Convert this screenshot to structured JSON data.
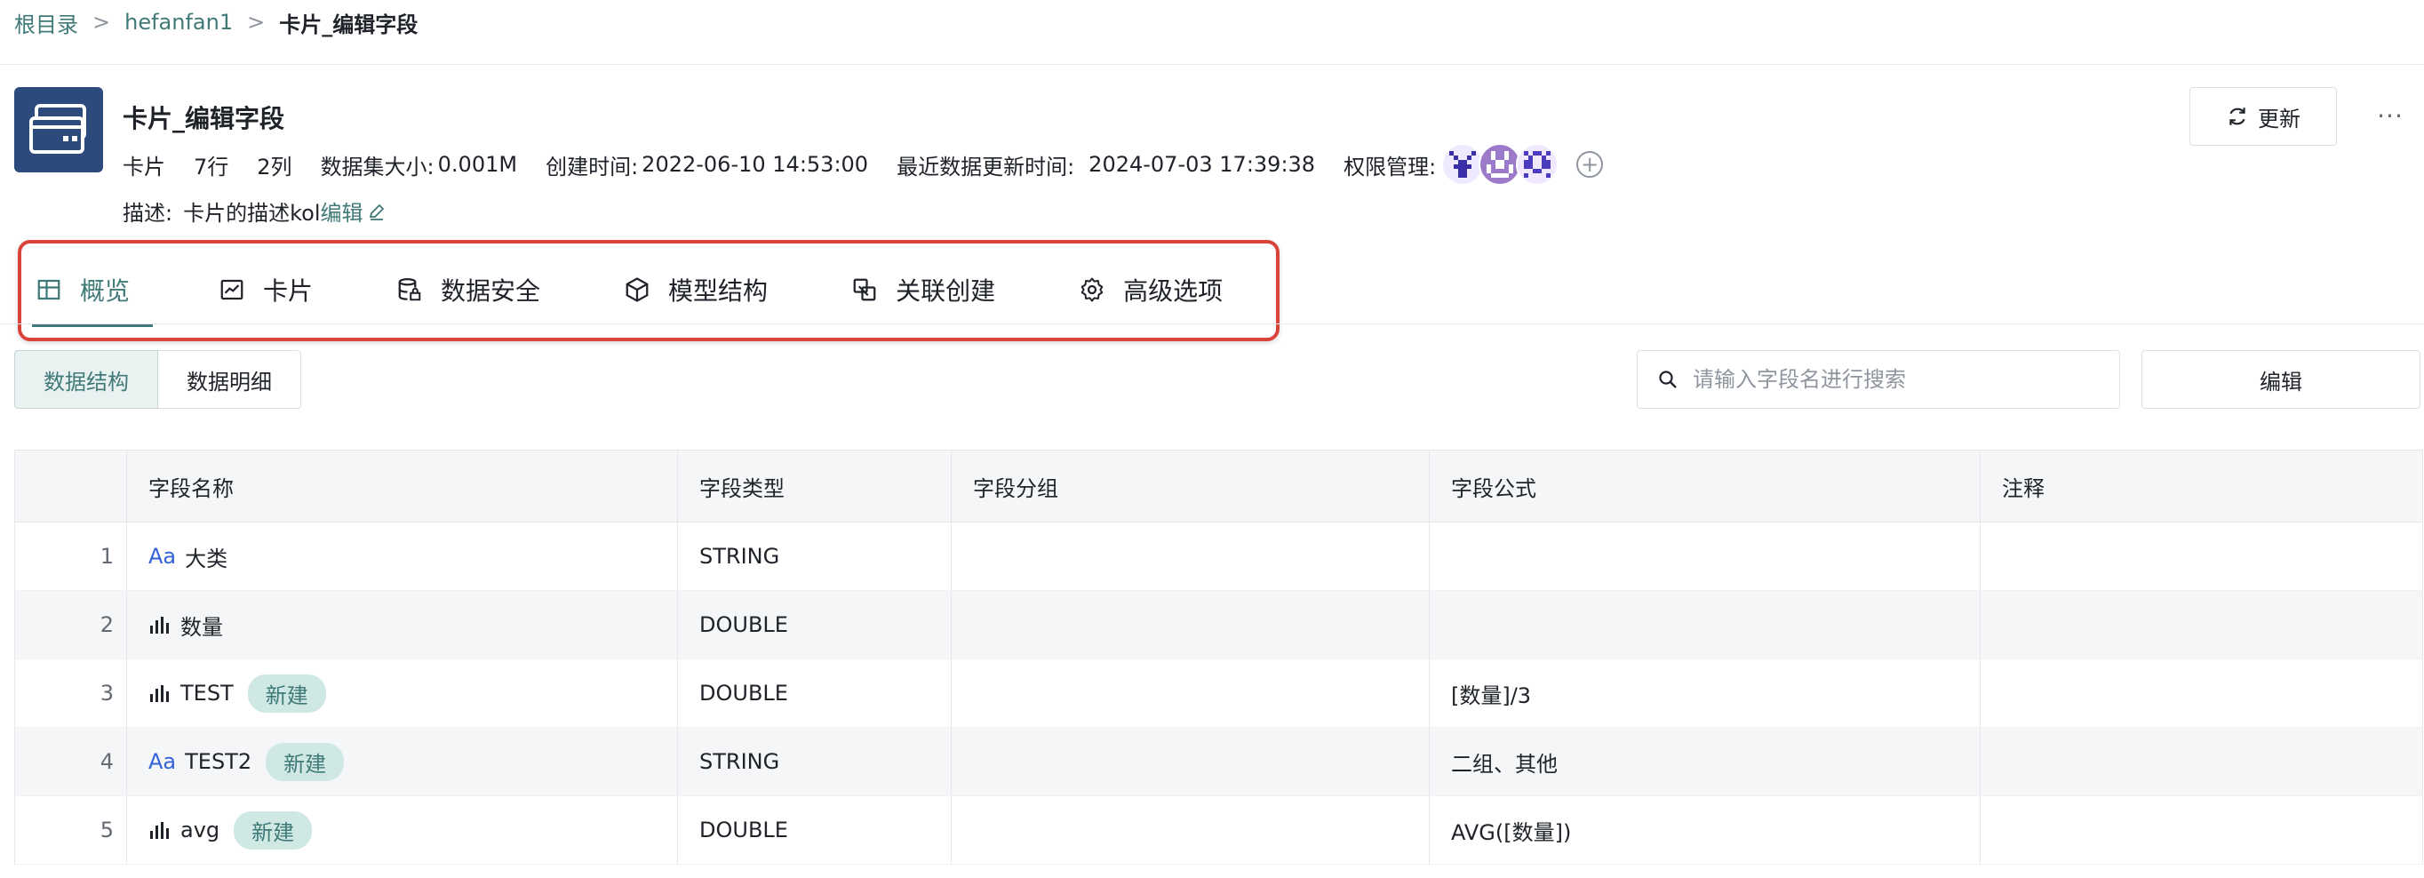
{
  "breadcrumb": {
    "root": "根目录",
    "folder": "hefanfan1",
    "current": "卡片_编辑字段",
    "separator": ">"
  },
  "dataset": {
    "title": "卡片_编辑字段",
    "meta": {
      "type": "卡片",
      "rows": "7行",
      "cols": "2列",
      "size_label": "数据集大小:",
      "size_value": "0.001M",
      "created_label": "创建时间:",
      "created_value": "2022-06-10 14:53:00",
      "updated_label": "最近数据更新时间:",
      "updated_value": "2024-07-03 17:39:38",
      "perm_label": "权限管理:"
    },
    "description_label": "描述:",
    "description": "卡片的描述kol",
    "edit_link": "编辑"
  },
  "actions": {
    "refresh": "更新",
    "more": "···"
  },
  "tabs": [
    {
      "label": "概览",
      "icon": "table-icon"
    },
    {
      "label": "卡片",
      "icon": "line-chart-icon"
    },
    {
      "label": "数据安全",
      "icon": "database-lock-icon"
    },
    {
      "label": "模型结构",
      "icon": "cube-icon"
    },
    {
      "label": "关联创建",
      "icon": "link-icon"
    },
    {
      "label": "高级选项",
      "icon": "gear-icon"
    }
  ],
  "segments": {
    "structure": "数据结构",
    "detail": "数据明细"
  },
  "search": {
    "placeholder": "请输入字段名进行搜索"
  },
  "edit_button": "编辑",
  "table": {
    "headers": [
      "",
      "字段名称",
      "字段类型",
      "字段分组",
      "字段公式",
      "注释"
    ],
    "rows": [
      {
        "idx": "1",
        "type_icon": "text-type-icon",
        "name": "大类",
        "badge": "",
        "dtype": "STRING",
        "group": "",
        "formula": "",
        "note": ""
      },
      {
        "idx": "2",
        "type_icon": "number-type-icon",
        "name": "数量",
        "badge": "",
        "dtype": "DOUBLE",
        "group": "",
        "formula": "",
        "note": ""
      },
      {
        "idx": "3",
        "type_icon": "number-type-icon",
        "name": "TEST",
        "badge": "新建",
        "dtype": "DOUBLE",
        "group": "",
        "formula": "[数量]/3",
        "note": ""
      },
      {
        "idx": "4",
        "type_icon": "text-type-icon",
        "name": "TEST2",
        "badge": "新建",
        "dtype": "STRING",
        "group": "",
        "formula": "二组、其他",
        "note": ""
      },
      {
        "idx": "5",
        "type_icon": "number-type-icon",
        "name": "avg",
        "badge": "新建",
        "dtype": "DOUBLE",
        "group": "",
        "formula": "AVG([数量])",
        "note": ""
      }
    ]
  },
  "text_type_symbol": "Aa",
  "colors": {
    "accent": "#3f7a78",
    "highlight": "#d9443a",
    "icon_bg": "#2c4a7c",
    "badge_bg": "#cfe8e4"
  }
}
